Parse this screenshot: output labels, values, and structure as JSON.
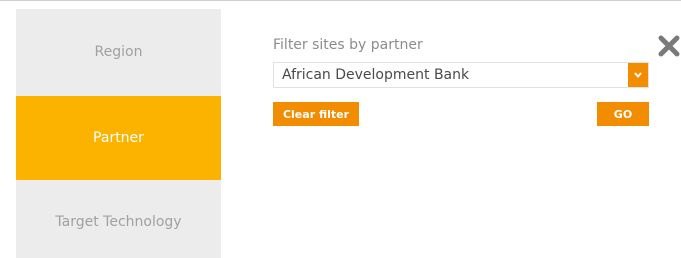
{
  "sidebar": {
    "items": [
      {
        "label": "Region",
        "active": false
      },
      {
        "label": "Partner",
        "active": true
      },
      {
        "label": "Target Technology",
        "active": false
      }
    ]
  },
  "filter": {
    "title": "Filter sites by partner",
    "selected_value": "African Development Bank",
    "clear_label": "Clear filter",
    "go_label": "GO"
  },
  "icons": {
    "close": "close-icon",
    "dropdown": "chevron-down-icon"
  },
  "colors": {
    "active_tab": "#fbb300",
    "button": "#f28c00",
    "sidebar_bg": "#ececec",
    "close_icon": "#7a7a7a"
  }
}
